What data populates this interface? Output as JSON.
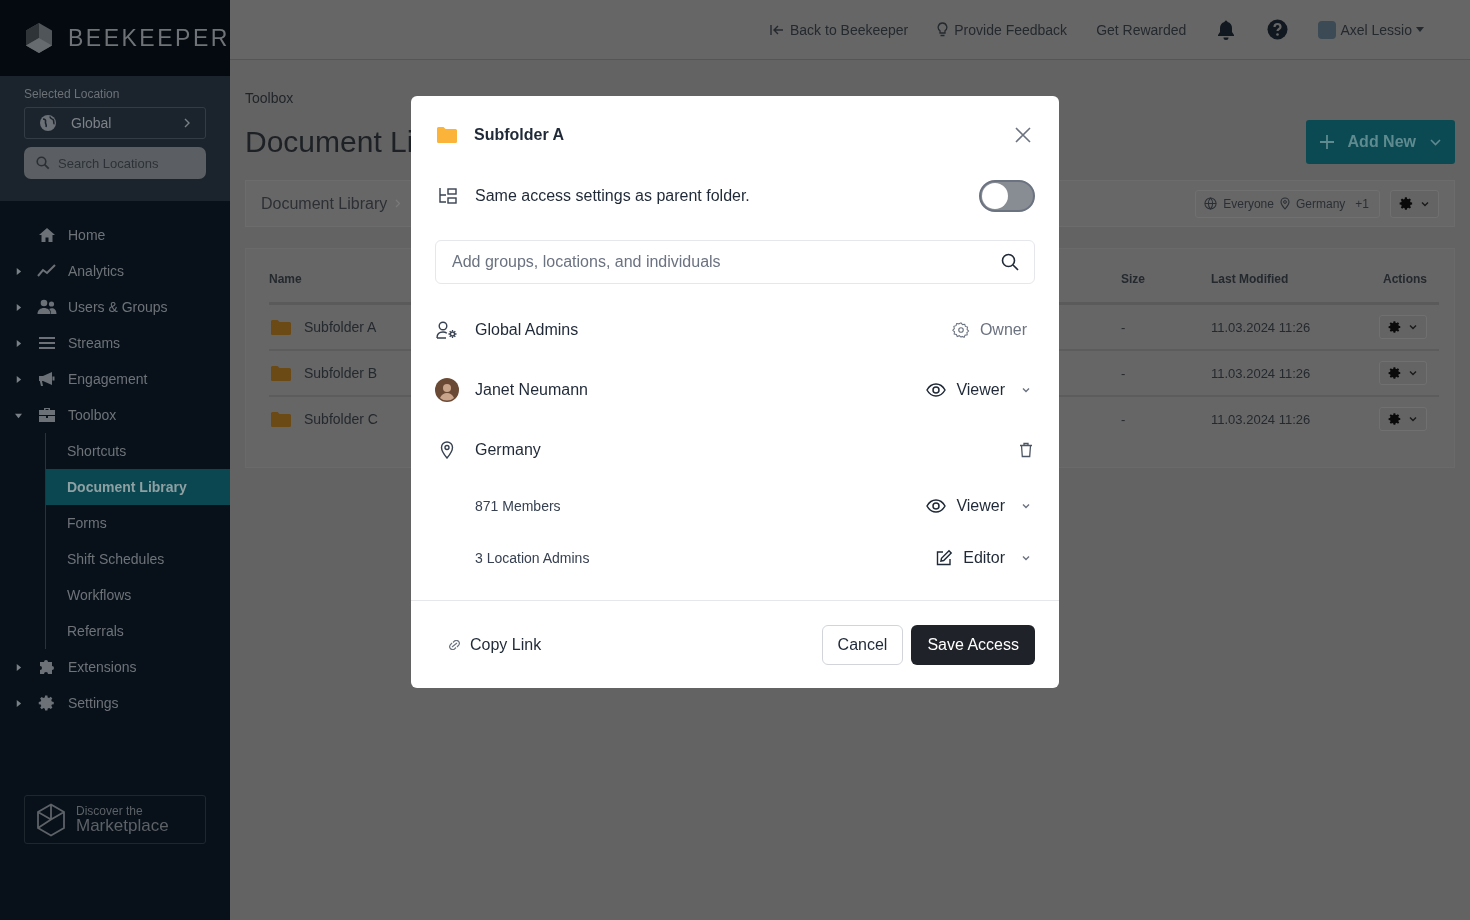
{
  "sidebar": {
    "logo_text": "BEEKEEPER",
    "location_label": "Selected Location",
    "location_value": "Global",
    "search": {
      "placeholder": "Search Locations"
    },
    "nav": [
      {
        "label": "Home",
        "kind": "link",
        "selected": false
      },
      {
        "label": "Analytics",
        "kind": "group",
        "expanded": false,
        "selected": false
      },
      {
        "label": "Users & Groups",
        "kind": "group",
        "expanded": false,
        "selected": false
      },
      {
        "label": "Streams",
        "kind": "group",
        "expanded": false,
        "selected": false
      },
      {
        "label": "Engagement",
        "kind": "group",
        "expanded": false,
        "selected": false
      },
      {
        "label": "Toolbox",
        "kind": "group",
        "expanded": true,
        "selected": false,
        "children": [
          {
            "label": "Shortcuts",
            "selected": false
          },
          {
            "label": "Document Library",
            "selected": true
          },
          {
            "label": "Forms",
            "selected": false
          },
          {
            "label": "Shift Schedules",
            "selected": false
          },
          {
            "label": "Workflows",
            "selected": false
          },
          {
            "label": "Referrals",
            "selected": false
          }
        ]
      },
      {
        "label": "Extensions",
        "kind": "group",
        "expanded": false,
        "selected": false
      },
      {
        "label": "Settings",
        "kind": "group",
        "expanded": false,
        "selected": false
      }
    ],
    "marketplace": {
      "line1": "Discover the",
      "line2": "Marketplace"
    }
  },
  "topbar": {
    "links": [
      {
        "label": "Back to Beekeeper",
        "kind": "back"
      },
      {
        "label": "Provide Feedback",
        "kind": "feedback"
      },
      {
        "label": "Get Rewarded",
        "kind": "plain"
      }
    ],
    "user_name": "Axel Lessio"
  },
  "main": {
    "breadcrumb": "Toolbox",
    "title": "Document Li",
    "add_button": "Add New",
    "path": "Document Library",
    "filters": {
      "audience": "Everyone",
      "location": "Germany",
      "more": "+1"
    },
    "table": {
      "columns": [
        "Name",
        "Size",
        "Last Modified",
        "Actions"
      ],
      "rows": [
        {
          "name": "Subfolder A",
          "size": "-",
          "modified": "11.03.2024 11:26"
        },
        {
          "name": "Subfolder B",
          "size": "-",
          "modified": "11.03.2024 11:26"
        },
        {
          "name": "Subfolder C",
          "size": "-",
          "modified": "11.03.2024 11:26"
        }
      ]
    }
  },
  "modal": {
    "title": "Subfolder A",
    "inherit": {
      "label": "Same access settings as parent folder.",
      "on": false
    },
    "search": {
      "placeholder": "Add groups, locations, and individuals"
    },
    "entries": [
      {
        "kind": "group",
        "name": "Global Admins",
        "access": {
          "label": "Owner",
          "kind": "owner",
          "dropdown": false
        }
      },
      {
        "kind": "person",
        "name": "Janet Neumann",
        "access": {
          "label": "Viewer",
          "kind": "viewer",
          "dropdown": true
        }
      },
      {
        "kind": "location",
        "name": "Germany",
        "removable": true,
        "children": [
          {
            "name": "871 Members",
            "access": {
              "label": "Viewer",
              "kind": "viewer",
              "dropdown": true
            }
          },
          {
            "name": "3 Location Admins",
            "access": {
              "label": "Editor",
              "kind": "editor",
              "dropdown": true
            }
          }
        ]
      }
    ],
    "copy_link": "Copy Link",
    "cancel": "Cancel",
    "save": "Save Access"
  }
}
